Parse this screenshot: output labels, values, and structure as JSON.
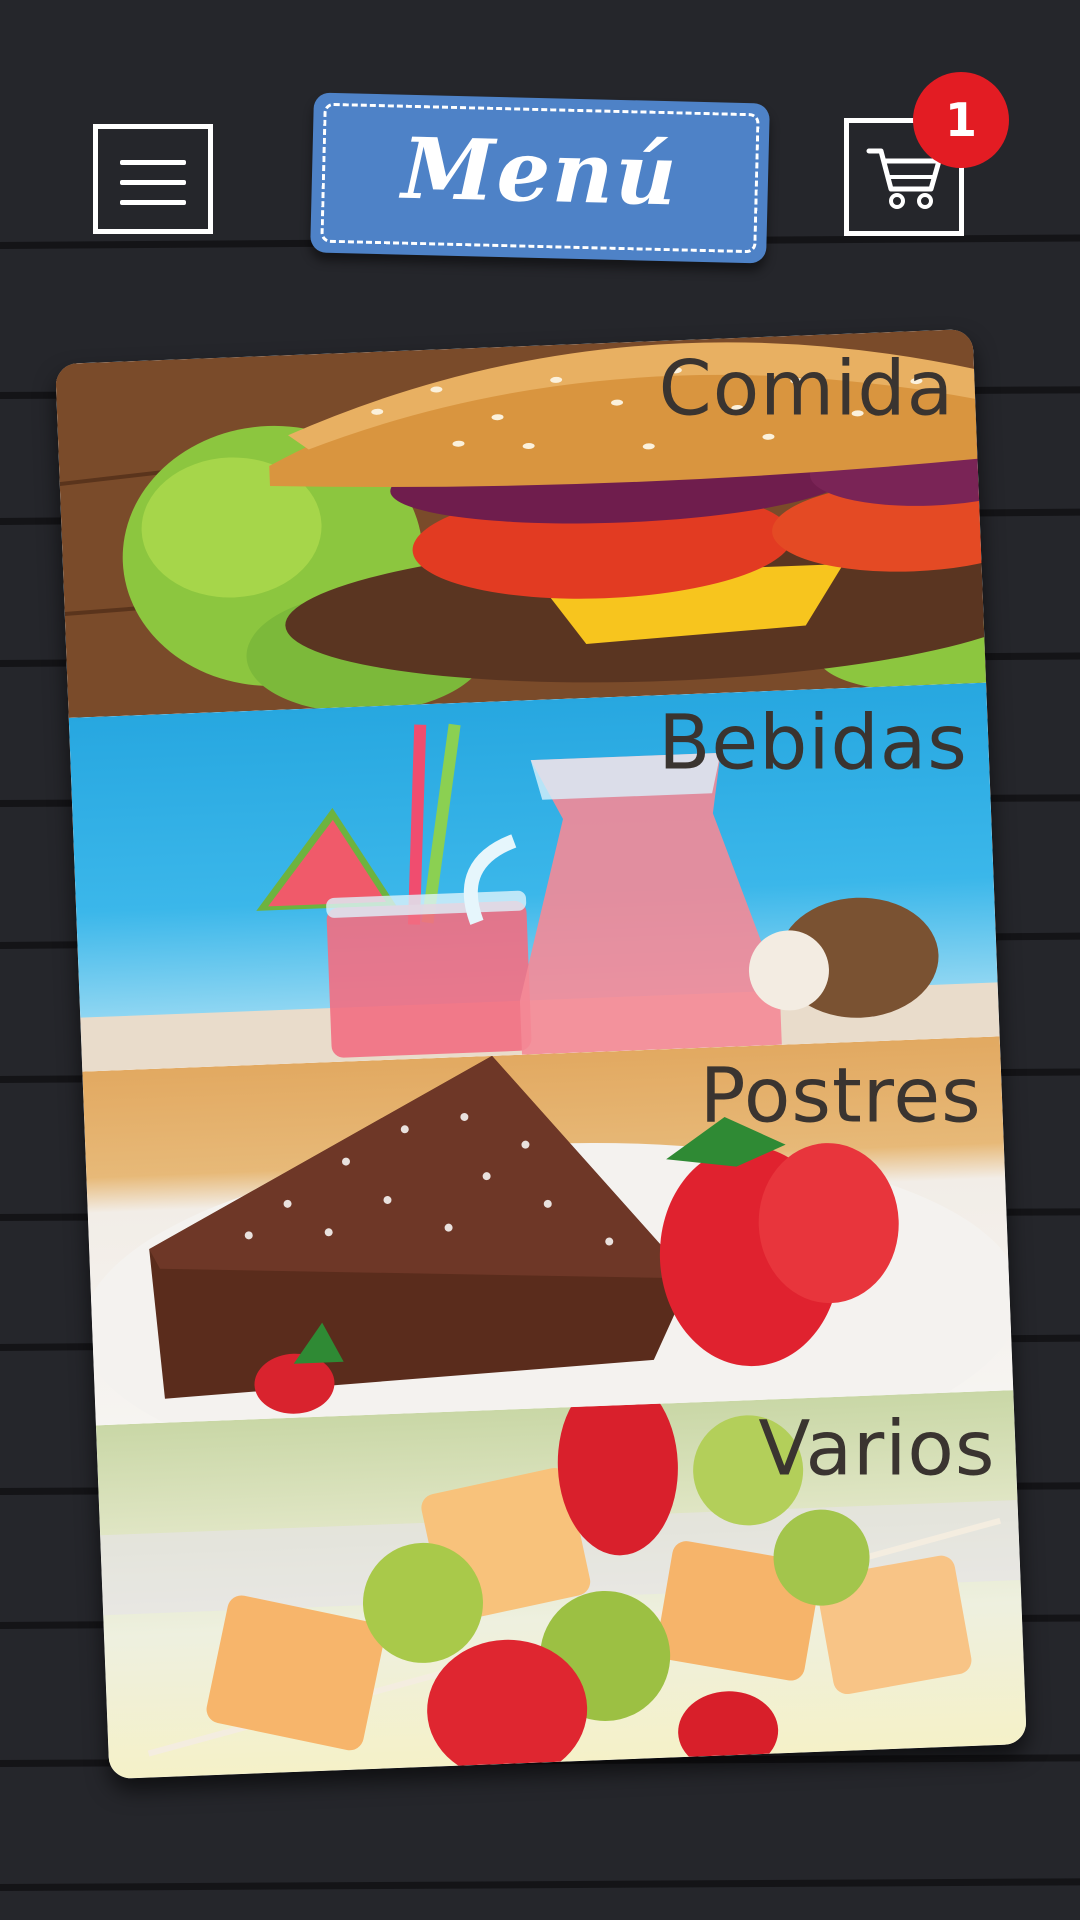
{
  "header": {
    "title": "Menú",
    "menu_icon": "hamburger-icon",
    "cart_icon": "shopping-cart-icon",
    "cart_count": "1"
  },
  "categories": [
    {
      "label": "Comida"
    },
    {
      "label": "Bebidas"
    },
    {
      "label": "Postres"
    },
    {
      "label": "Varios"
    }
  ],
  "colors": {
    "background": "#25262b",
    "title_label": "#4e82c7",
    "badge": "#e31c23",
    "category_text": "#3a3430"
  }
}
